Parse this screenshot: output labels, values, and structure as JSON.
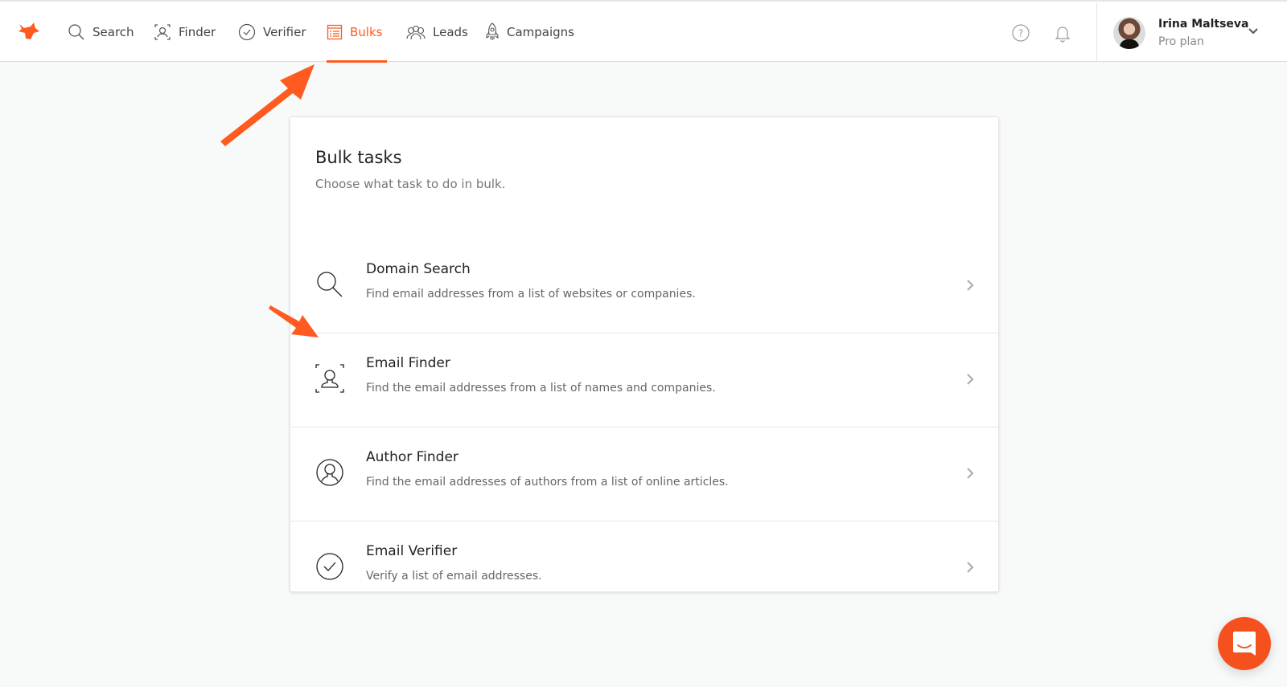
{
  "brand": {
    "accent": "#ff5a1f",
    "logo": "fox-logo-icon"
  },
  "nav": {
    "items": [
      {
        "label": "Search",
        "icon": "search-icon",
        "active": false
      },
      {
        "label": "Finder",
        "icon": "finder-icon",
        "active": false
      },
      {
        "label": "Verifier",
        "icon": "verifier-check-icon",
        "active": false
      },
      {
        "label": "Bulks",
        "icon": "bulks-list-icon",
        "active": true
      },
      {
        "label": "Leads",
        "icon": "leads-people-icon",
        "active": false
      },
      {
        "label": "Campaigns",
        "icon": "campaigns-rocket-icon",
        "active": false
      }
    ],
    "help_icon": "help-circle-icon",
    "notifications_icon": "bell-icon"
  },
  "user": {
    "name": "Irina Maltseva",
    "plan": "Pro plan"
  },
  "card": {
    "title": "Bulk tasks",
    "subtitle": "Choose what task to do in bulk.",
    "tasks": [
      {
        "title": "Domain Search",
        "description": "Find email addresses from a list of websites or companies.",
        "icon": "search-icon"
      },
      {
        "title": "Email Finder",
        "description": "Find the email addresses from a list of names and companies.",
        "icon": "finder-icon"
      },
      {
        "title": "Author Finder",
        "description": "Find the email addresses of authors from a list of online articles.",
        "icon": "author-icon"
      },
      {
        "title": "Email Verifier",
        "description": "Verify a list of email addresses.",
        "icon": "verifier-check-icon"
      }
    ]
  },
  "chat": {
    "icon": "chat-icon",
    "color": "#f4511e"
  }
}
